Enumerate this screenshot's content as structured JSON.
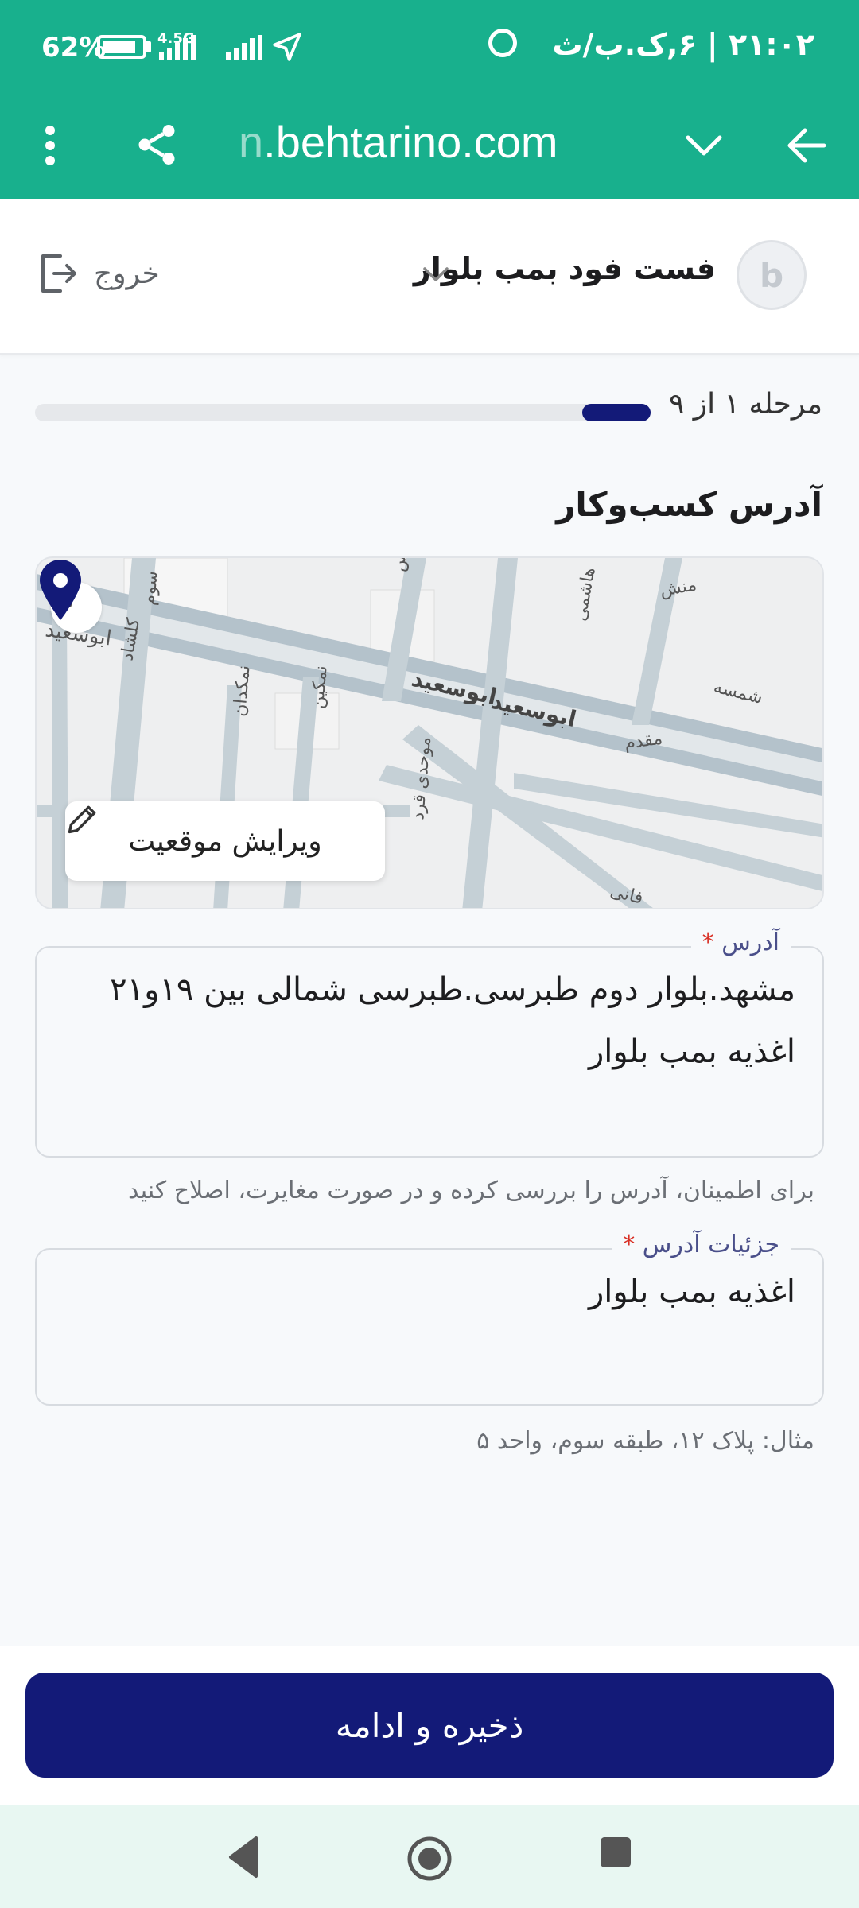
{
  "status_bar": {
    "time": "۲۱:۰۲ | ۶,ک.ب/ث",
    "battery_percent": "62%",
    "network": "4.5G",
    "battery_level": 0.62,
    "icons": [
      "alarm-icon",
      "battery-icon",
      "signal-icon",
      "location-arrow-icon"
    ]
  },
  "browser": {
    "url_prefix": "n",
    "url": ".behtarino.com",
    "icons": [
      "back-arrow-icon",
      "chevron-down-icon",
      "share-icon",
      "more-vert-icon"
    ]
  },
  "header": {
    "logo_letter": "b",
    "business_name": "فست فود بمب بلوار",
    "logout_label": "خروج"
  },
  "progress": {
    "step_label": "مرحله ۱ از ۹",
    "current_step": 1,
    "total_steps": 9
  },
  "section_title": "آدرس کسب‌وکار",
  "map": {
    "edit_location_label": "ویرایش موقعیت",
    "street_labels": [
      "ابوسعید",
      "ابوسعید",
      "ابوسعید",
      "شمس",
      "هاشمی",
      "شمسه",
      "منش",
      "مقدم",
      "فانی",
      "سوم",
      "کلشاد",
      "نمکدان",
      "نمکین",
      "موحدی قرد"
    ]
  },
  "address_field": {
    "label": "آدرس",
    "required_mark": "*",
    "value": "مشهد.بلوار دوم طبرسی.طبرسی شمالی بین ۱۹و۲۱ اغذیه بمب بلوار",
    "helper": "برای اطمینان، آدرس را بررسی کرده و در صورت مغایرت، اصلاح کنید"
  },
  "details_field": {
    "label": "جزئیات آدرس",
    "required_mark": "*",
    "value": "اغذیه بمب بلوار",
    "helper": "مثال: پلاک ۱۲، طبقه سوم، واحد ۵"
  },
  "submit_label": "ذخیره و ادامه",
  "colors": {
    "brand_green": "#18b08d",
    "primary_navy": "#131a78",
    "required_red": "#d93025"
  }
}
